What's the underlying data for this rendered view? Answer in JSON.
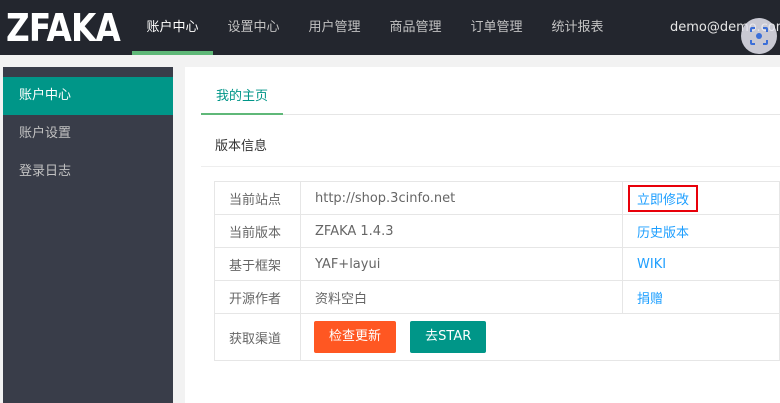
{
  "logo": "ZFAKA",
  "topnav": [
    {
      "label": "账户中心",
      "active": true
    },
    {
      "label": "设置中心"
    },
    {
      "label": "用户管理"
    },
    {
      "label": "商品管理"
    },
    {
      "label": "订单管理"
    },
    {
      "label": "统计报表"
    }
  ],
  "user_email": "demo@demo.com",
  "sidebar": {
    "items": [
      {
        "label": "账户中心",
        "active": true
      },
      {
        "label": "账户设置"
      },
      {
        "label": "登录日志"
      }
    ]
  },
  "main": {
    "tab": "我的主页",
    "section_title": "版本信息",
    "rows": [
      {
        "label": "当前站点",
        "value": "http://shop.3cinfo.net",
        "link": "立即修改"
      },
      {
        "label": "当前版本",
        "value": "ZFAKA 1.4.3",
        "link": "历史版本"
      },
      {
        "label": "基于框架",
        "value": "YAF+layui",
        "link": "WIKI"
      },
      {
        "label": "开源作者",
        "value": "资料空白",
        "link": "捐赠"
      }
    ],
    "channel_label": "获取渠道",
    "check_update_label": "检查更新",
    "star_label": "去STAR"
  },
  "colors": {
    "header_bg": "#23262e",
    "sidebar_bg": "#393d49",
    "accent": "#009688",
    "link": "#1e9fff",
    "orange": "#ff5722",
    "highlight": "#e8000a"
  },
  "icons": {
    "lens": "scan-lens-icon"
  }
}
